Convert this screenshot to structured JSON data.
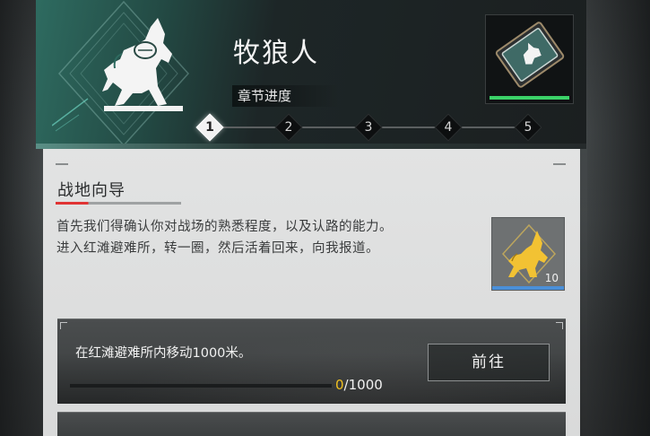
{
  "header": {
    "chapter_title": "牧狼人",
    "progress_label": "章节进度",
    "emblem_icon": "wolf-emblem-icon",
    "accent_color": "#2e6b60"
  },
  "steps": [
    {
      "label": "1",
      "active": true
    },
    {
      "label": "2",
      "active": false
    },
    {
      "label": "3",
      "active": false
    },
    {
      "label": "4",
      "active": false
    },
    {
      "label": "5",
      "active": false
    }
  ],
  "chapter_reward": {
    "icon": "wolf-badge-plate-icon",
    "status_color": "#3bd268"
  },
  "section": {
    "title": "战地向导",
    "description_line1": "首先我们得确认你对战场的熟悉程度，以及认路的能力。",
    "description_line2": "进入红滩避难所，转一圈，然后活着回来，向我报道。"
  },
  "item_reward": {
    "icon": "gold-wolf-icon",
    "quantity": "10",
    "rarity_color": "#4a8fd8"
  },
  "task": {
    "description": "在红滩避难所内移动1000米。",
    "button_label": "前往",
    "progress_current": "0",
    "progress_total": "/1000",
    "progress_fraction": 0.0
  }
}
